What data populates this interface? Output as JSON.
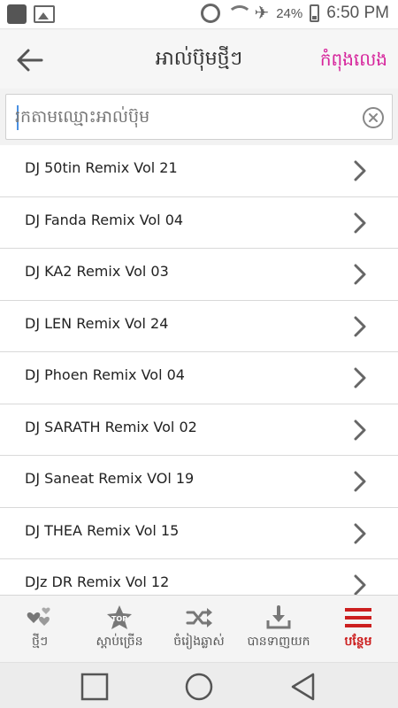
{
  "status_bar": {
    "battery": "24%",
    "time": "6:50 PM",
    "icons": [
      "app-icon",
      "gallery-icon",
      "alarm-icon",
      "wifi-icon",
      "airplane-icon",
      "battery-icon"
    ]
  },
  "header": {
    "back_icon": "arrow-left-icon",
    "title": "អាល់ប៊ុមថ្មីៗ",
    "now_playing": "កំពុងលេង"
  },
  "search": {
    "placeholder": "រកតាមឈ្មោះអាល់ប៊ុម",
    "value": "",
    "clear_icon": "clear-circle-icon"
  },
  "albums": [
    {
      "label": "DJ 50tin Remix Vol 21"
    },
    {
      "label": "DJ Fanda Remix Vol 04"
    },
    {
      "label": "DJ KA2 Remix Vol 03"
    },
    {
      "label": "DJ LEN Remix Vol 24"
    },
    {
      "label": "DJ Phoen Remix Vol 04"
    },
    {
      "label": "DJ SARATH Remix Vol 02"
    },
    {
      "label": "DJ Saneat Remix VOl 19"
    },
    {
      "label": "DJ THEA Remix Vol 15"
    },
    {
      "label": "DJz DR Remix Vol 12"
    }
  ],
  "tabs": [
    {
      "label": "ថ្មីៗ",
      "icon": "hearts-icon"
    },
    {
      "label": "ស្ដាប់ច្រើន",
      "icon": "top-star-icon",
      "badge": "TOP"
    },
    {
      "label": "ចំរៀងឆ្លាស់",
      "icon": "shuffle-icon"
    },
    {
      "label": "បានទាញយក",
      "icon": "download-icon"
    },
    {
      "label": "បន្ថែម",
      "icon": "menu-icon",
      "active": true
    }
  ],
  "colors": {
    "accent_pink": "#d6259c",
    "active_red": "#cc1f1f",
    "icon_gray": "#6a6a6a"
  },
  "nav": {
    "icons": [
      "recents-square-icon",
      "home-circle-icon",
      "back-triangle-icon"
    ]
  }
}
